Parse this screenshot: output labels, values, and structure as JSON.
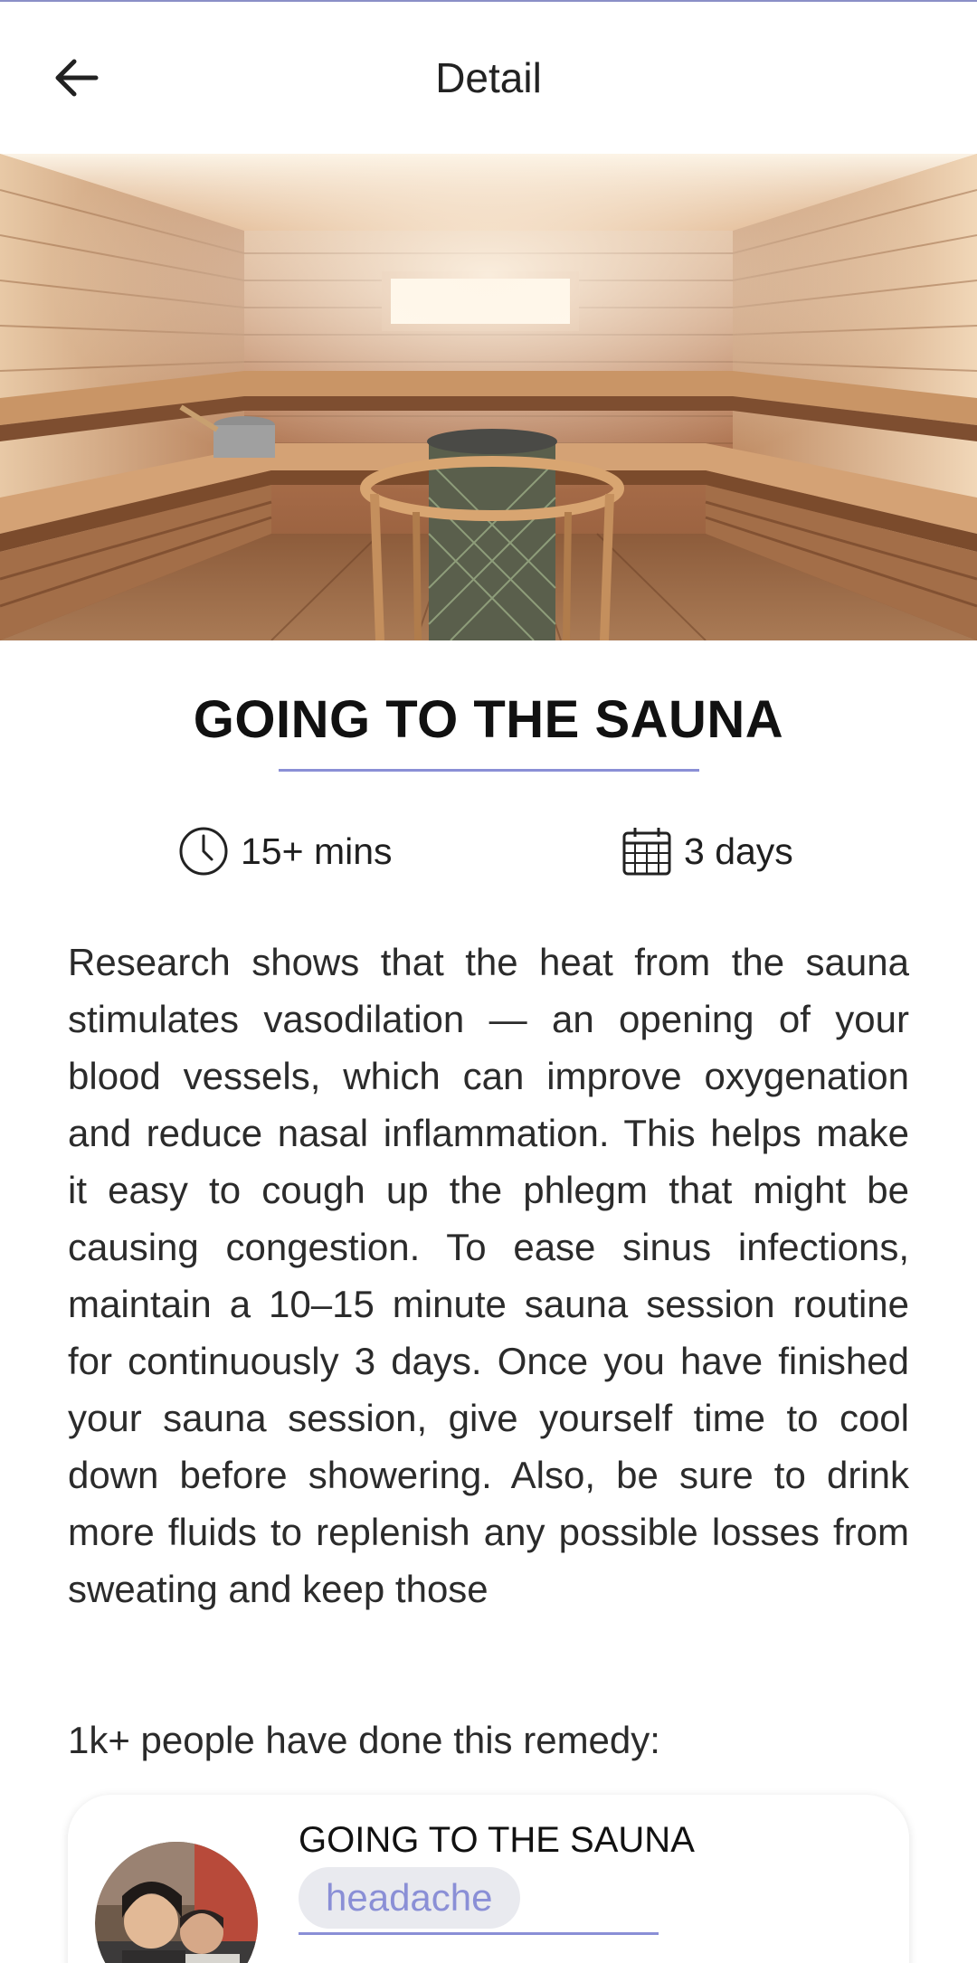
{
  "header": {
    "title": "Detail"
  },
  "detail": {
    "title": "GOING TO THE SAUNA",
    "duration": "15+ mins",
    "days": "3 days",
    "description": "Research shows that the heat from the sauna stimulates vasodilation — an opening of your blood vessels, which can improve oxygenation and reduce nasal inflammation. This helps make it easy to cough up the phlegm that might be causing congestion. To ease sinus infections, maintain a 10–15 minute sauna session routine for continuously 3 days. Once you have finished your sauna session, give yourself time to cool down before showering. Also, be sure to drink more fluids to replenish any possible losses from sweating and keep those"
  },
  "people": {
    "label": "1k+ people have done this remedy:"
  },
  "card": {
    "title": "GOING TO THE SAUNA",
    "tag": "headache"
  },
  "colors": {
    "accent": "#8a8fd6",
    "tag_bg": "#e9eaef",
    "wood": "#b9845a"
  }
}
